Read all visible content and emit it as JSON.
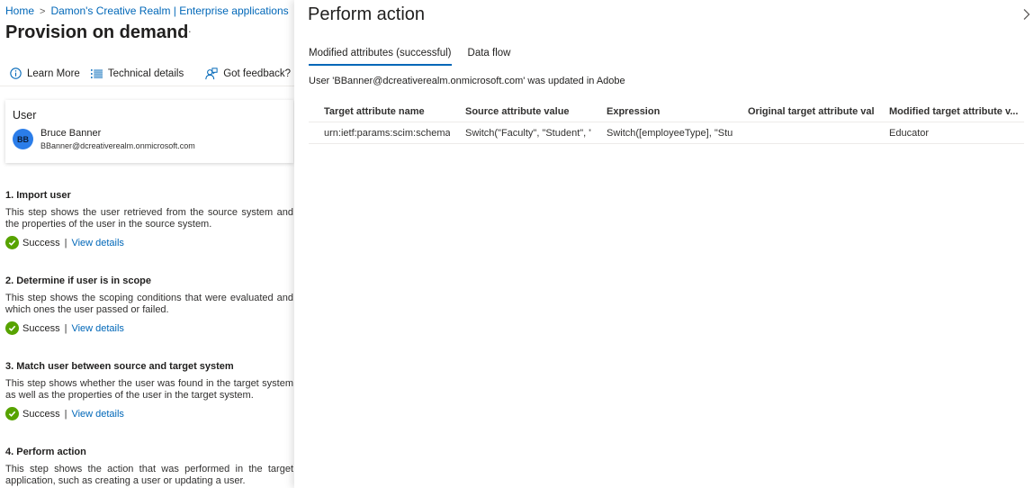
{
  "breadcrumb": [
    {
      "label": "Home"
    },
    {
      "label": "Damon's Creative Realm | Enterprise applications"
    },
    {
      "label": "Enterpr"
    }
  ],
  "page_title": "Provision on demand",
  "more_label": "···",
  "toolbar": {
    "learn_more": "Learn More",
    "technical_details": "Technical details",
    "feedback": "Got feedback?"
  },
  "user_card": {
    "label": "User",
    "initials": "BB",
    "name": "Bruce Banner",
    "email": "BBanner@dcreativerealm.onmicrosoft.com"
  },
  "steps": [
    {
      "title": "1. Import user",
      "description": "This step shows the user retrieved from the source system and the properties of the user in the source system.",
      "status": "Success",
      "link": "View details"
    },
    {
      "title": "2. Determine if user is in scope",
      "description": "This step shows the scoping conditions that were evaluated and which ones the user passed or failed.",
      "status": "Success",
      "link": "View details"
    },
    {
      "title": "3. Match user between source and target system",
      "description": "This step shows whether the user was found in the target system as well as the properties of the user in the target system.",
      "status": "Success",
      "link": "View details"
    },
    {
      "title": "4. Perform action",
      "description": "This step shows the action that was performed in the target application, such as creating a user or updating a user."
    }
  ],
  "panel": {
    "title": "Perform action",
    "tabs": [
      {
        "label": "Modified attributes (successful)",
        "active": true
      },
      {
        "label": "Data flow",
        "active": false
      }
    ],
    "message": "User 'BBanner@dcreativerealm.onmicrosoft.com' was updated in Adobe",
    "table": {
      "columns": [
        "Target attribute name",
        "Source attribute value",
        "Expression",
        "Original target attribute val...",
        "Modified target attribute v..."
      ],
      "rows": [
        [
          "urn:ietf:params:scim:schemas:...",
          "Switch(\"Faculty\", \"Student\", \"F...",
          "Switch([employeeType], \"Stud...",
          "",
          "Educator"
        ]
      ]
    }
  },
  "colors": {
    "accent": "#0067b8",
    "success": "#57a300",
    "avatar": "#2b7de9"
  }
}
